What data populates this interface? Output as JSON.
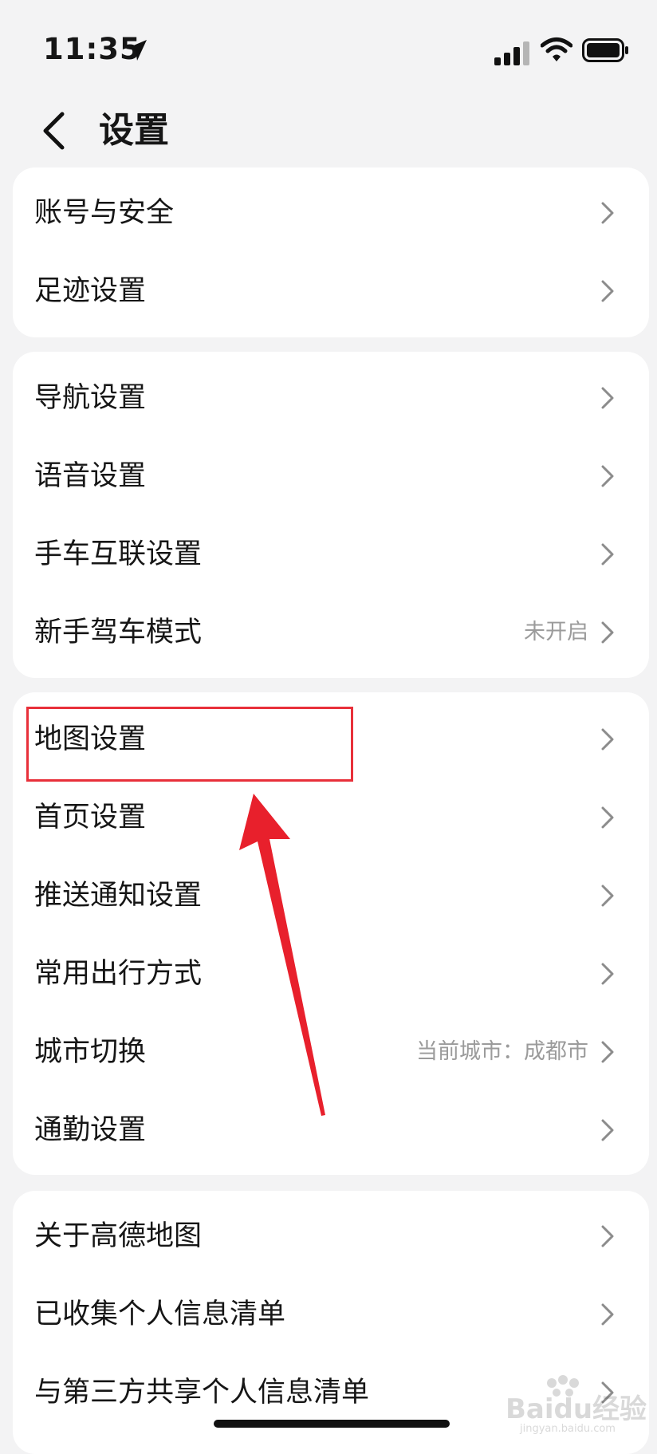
{
  "status_bar": {
    "time": "11:35"
  },
  "header": {
    "title": "设置"
  },
  "groups": [
    {
      "items": [
        {
          "label": "账号与安全"
        },
        {
          "label": "足迹设置"
        }
      ]
    },
    {
      "items": [
        {
          "label": "导航设置"
        },
        {
          "label": "语音设置"
        },
        {
          "label": "手车互联设置"
        },
        {
          "label": "新手驾车模式",
          "value": "未开启"
        }
      ]
    },
    {
      "items": [
        {
          "label": "地图设置"
        },
        {
          "label": "首页设置"
        },
        {
          "label": "推送通知设置"
        },
        {
          "label": "常用出行方式"
        },
        {
          "label": "城市切换",
          "value": "当前城市：成都市"
        },
        {
          "label": "通勤设置"
        }
      ]
    },
    {
      "items": [
        {
          "label": "关于高德地图"
        },
        {
          "label": "已收集个人信息清单"
        },
        {
          "label": "与第三方共享个人信息清单"
        }
      ]
    }
  ],
  "watermark": {
    "brand": "Baidu经验",
    "url": "jingyan.baidu.com"
  },
  "colors": {
    "background": "#f3f3f4",
    "card": "#ffffff",
    "annotation": "#e8303a",
    "secondary_text": "#9b9b9b"
  },
  "icons": [
    "location-arrow-icon",
    "cellular-signal-icon",
    "wifi-icon",
    "battery-icon",
    "back-chevron-icon",
    "chevron-right-icon"
  ]
}
